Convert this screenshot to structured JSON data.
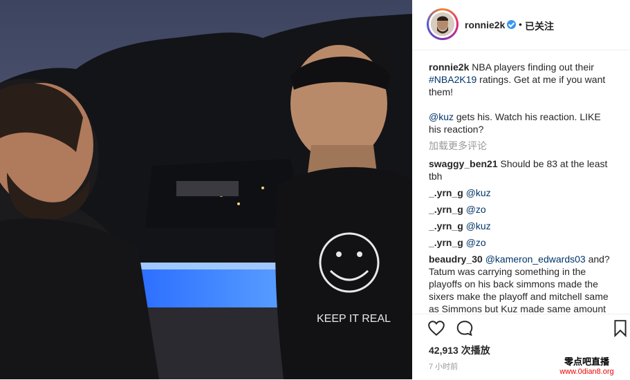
{
  "header": {
    "username": "ronnie2k",
    "separator": "•",
    "follow_status": "已关注"
  },
  "caption": {
    "user": "ronnie2k",
    "text_1": "NBA players finding out their",
    "hashtag": "#NBA2K19",
    "text_2": "ratings. Get at me if you want them!",
    "mention": "@kuz",
    "text_3": "gets his. Watch his reaction. LIKE his reaction?"
  },
  "load_more": "加载更多评论",
  "comments": [
    {
      "user": "swaggy_ben21",
      "text": "Should be 83 at the least tbh"
    },
    {
      "user": "_.yrn_g",
      "text": "@kuz"
    },
    {
      "user": "_.yrn_g",
      "text": "@zo"
    },
    {
      "user": "_.yrn_g",
      "text": "@kuz"
    },
    {
      "user": "_.yrn_g",
      "text": "@zo"
    },
    {
      "user": "beaudry_30",
      "mention": "@kameron_edwards03",
      "text": "and? Tatum was carrying something in the playoffs on his back simmons made the sixers make the playoff and mitchell same as Simmons but Kuz made same amount of"
    }
  ],
  "actions": {
    "views": "42,913 次播放",
    "time": "7 小时前"
  },
  "watermark": {
    "line1": "零点吧直播",
    "line2": "www.0dian8.org"
  },
  "shirt_text": "KEEP IT REAL"
}
